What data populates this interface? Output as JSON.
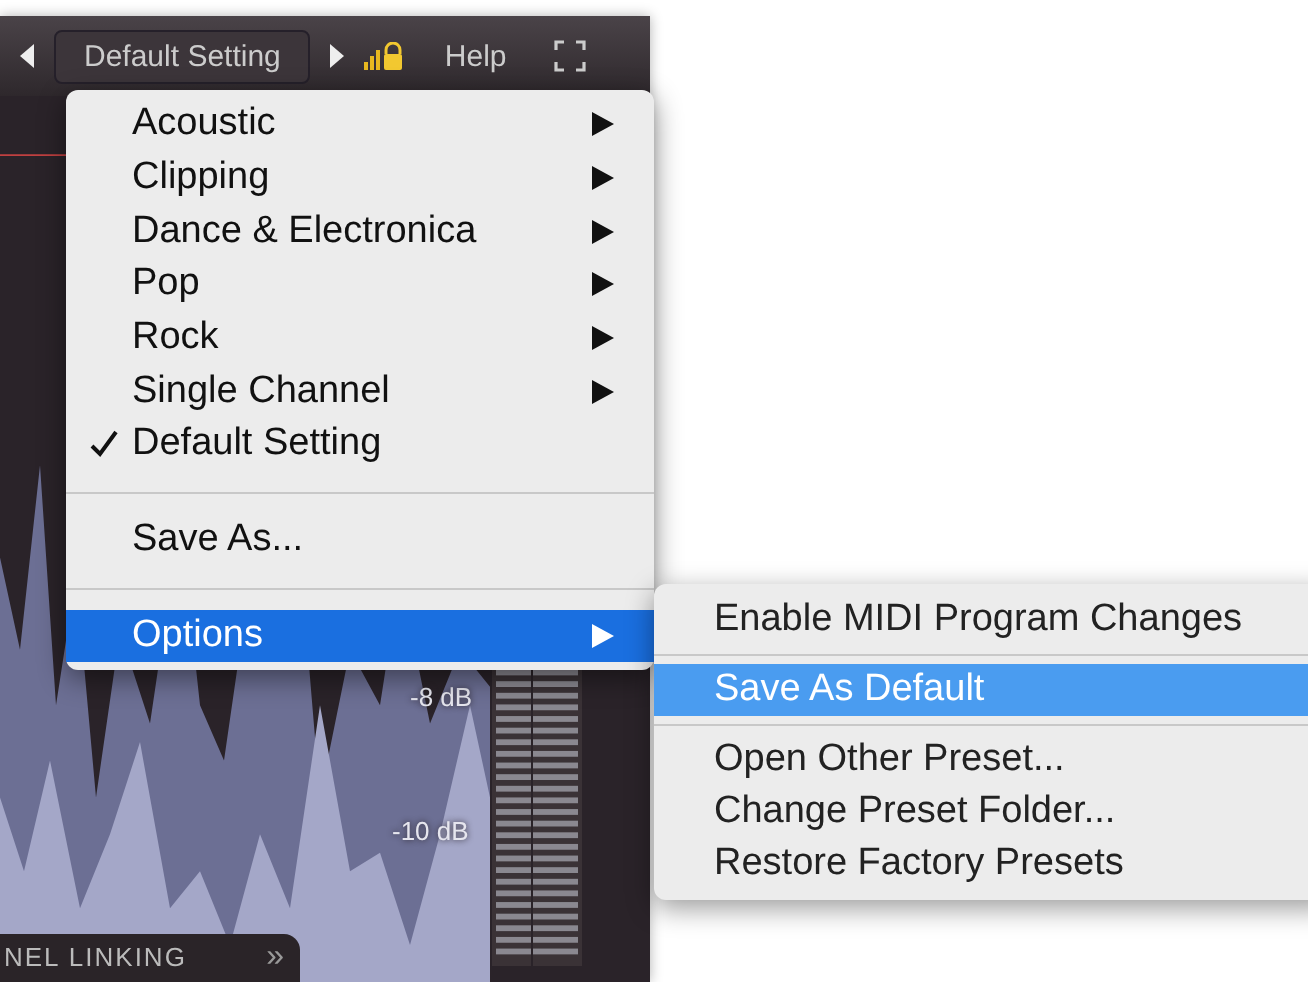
{
  "toolbar": {
    "preset": "Default Setting",
    "help": "Help"
  },
  "menu": [
    {
      "kind": "item",
      "label": "Acoustic",
      "submenu": true,
      "checked": false,
      "selected": false
    },
    {
      "kind": "item",
      "label": "Clipping",
      "submenu": true,
      "checked": false,
      "selected": false
    },
    {
      "kind": "item",
      "label": "Dance & Electronica",
      "submenu": true,
      "checked": false,
      "selected": false
    },
    {
      "kind": "item",
      "label": "Pop",
      "submenu": true,
      "checked": false,
      "selected": false
    },
    {
      "kind": "item",
      "label": "Rock",
      "submenu": true,
      "checked": false,
      "selected": false
    },
    {
      "kind": "item",
      "label": "Single Channel",
      "submenu": true,
      "checked": false,
      "selected": false
    },
    {
      "kind": "item",
      "label": "Default Setting",
      "submenu": false,
      "checked": true,
      "selected": false
    },
    {
      "kind": "separator"
    },
    {
      "kind": "item",
      "label": "Save As...",
      "submenu": false,
      "checked": false,
      "selected": false
    },
    {
      "kind": "separator"
    },
    {
      "kind": "item",
      "label": "Options",
      "submenu": true,
      "checked": false,
      "selected": true
    }
  ],
  "submenu": [
    {
      "kind": "item",
      "label": "Enable MIDI Program Changes",
      "selected": false
    },
    {
      "kind": "separator"
    },
    {
      "kind": "item",
      "label": "Save As Default",
      "selected": true
    },
    {
      "kind": "separator"
    },
    {
      "kind": "item",
      "label": "Open Other Preset...",
      "selected": false
    },
    {
      "kind": "item",
      "label": "Change Preset Folder...",
      "selected": false
    },
    {
      "kind": "item",
      "label": "Restore Factory Presets",
      "selected": false
    }
  ],
  "scale_labels": [
    "-8 dB",
    "-10 dB"
  ],
  "bottom": {
    "label": "NEL LINKING",
    "arrow": "»"
  }
}
